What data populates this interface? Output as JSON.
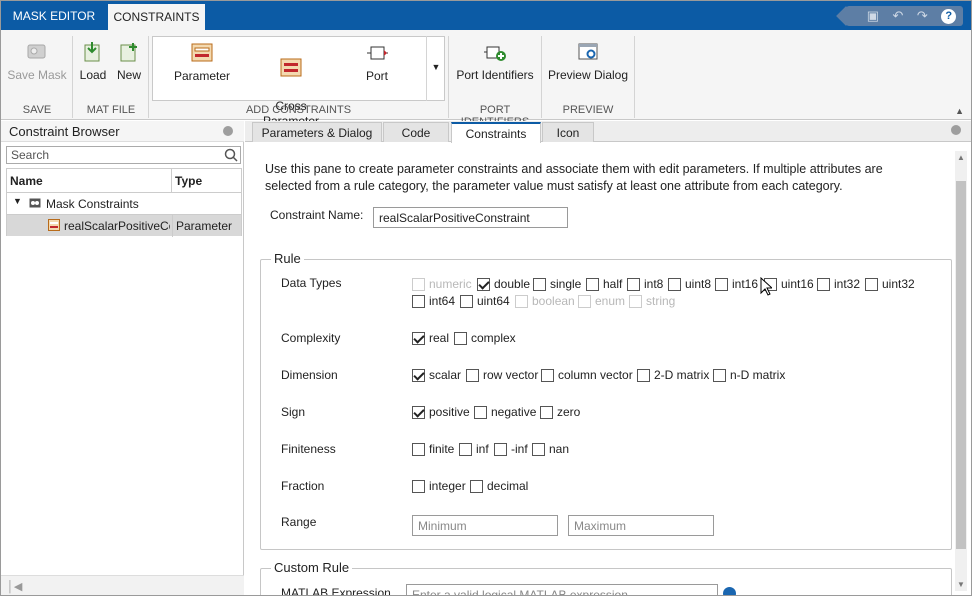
{
  "title_tabs": [
    {
      "label": "MASK EDITOR"
    },
    {
      "label": "CONSTRAINTS"
    }
  ],
  "quick_access": {
    "save_icon": "save-icon",
    "undo_icon": "undo-icon",
    "redo_icon": "redo-icon",
    "help_label": "?"
  },
  "ribbon": {
    "save_mask": "Save Mask",
    "load": "Load",
    "new": "New",
    "parameter": "Parameter",
    "cross_parameter": "Cross\nParameter",
    "port": "Port",
    "port_identifiers": "Port Identifiers",
    "preview_dialog": "Preview Dialog",
    "groups": {
      "save": "SAVE",
      "mat_file": "MAT FILE",
      "add_constraints": "ADD CONSTRAINTS",
      "port_identifiers": "PORT IDENTIFIERS",
      "preview": "PREVIEW"
    }
  },
  "browser": {
    "title": "Constraint Browser",
    "search_placeholder": "Search",
    "columns": [
      "Name",
      "Type"
    ],
    "root": "Mask Constraints",
    "rows": [
      {
        "name": "realScalarPositiveCo",
        "type": "Parameter"
      }
    ]
  },
  "main_tabs": [
    "Parameters & Dialog",
    "Code",
    "Constraints",
    "Icon"
  ],
  "description": "Use this pane to create parameter constraints and associate them with edit parameters. If multiple attributes are selected from a rule category, the parameter value must satisfy at least one attribute from each category.",
  "constraint_name_label": "Constraint Name:",
  "constraint_name_value": "realScalarPositiveConstraint",
  "rule": {
    "legend": "Rule",
    "data_types_label": "Data Types",
    "data_types": [
      {
        "label": "numeric",
        "checked": false,
        "disabled": true
      },
      {
        "label": "double",
        "checked": true,
        "disabled": false
      },
      {
        "label": "single",
        "checked": false,
        "disabled": false
      },
      {
        "label": "half",
        "checked": false,
        "disabled": false
      },
      {
        "label": "int8",
        "checked": false,
        "disabled": false
      },
      {
        "label": "uint8",
        "checked": false,
        "disabled": false
      },
      {
        "label": "int16",
        "checked": false,
        "disabled": false
      },
      {
        "label": "uint16",
        "checked": false,
        "disabled": false
      },
      {
        "label": "int32",
        "checked": false,
        "disabled": false
      },
      {
        "label": "uint32",
        "checked": false,
        "disabled": false
      },
      {
        "label": "int64",
        "checked": false,
        "disabled": false
      },
      {
        "label": "uint64",
        "checked": false,
        "disabled": false
      },
      {
        "label": "boolean",
        "checked": false,
        "disabled": true
      },
      {
        "label": "enum",
        "checked": false,
        "disabled": true
      },
      {
        "label": "string",
        "checked": false,
        "disabled": true
      }
    ],
    "complexity_label": "Complexity",
    "complexity": [
      {
        "label": "real",
        "checked": true
      },
      {
        "label": "complex",
        "checked": false
      }
    ],
    "dimension_label": "Dimension",
    "dimension": [
      {
        "label": "scalar",
        "checked": true
      },
      {
        "label": "row vector",
        "checked": false
      },
      {
        "label": "column vector",
        "checked": false
      },
      {
        "label": "2-D matrix",
        "checked": false
      },
      {
        "label": "n-D matrix",
        "checked": false
      }
    ],
    "sign_label": "Sign",
    "sign": [
      {
        "label": "positive",
        "checked": true
      },
      {
        "label": "negative",
        "checked": false
      },
      {
        "label": "zero",
        "checked": false
      }
    ],
    "finiteness_label": "Finiteness",
    "finiteness": [
      {
        "label": "finite",
        "checked": false
      },
      {
        "label": "inf",
        "checked": false
      },
      {
        "label": "-inf",
        "checked": false
      },
      {
        "label": "nan",
        "checked": false
      }
    ],
    "fraction_label": "Fraction",
    "fraction": [
      {
        "label": "integer",
        "checked": false
      },
      {
        "label": "decimal",
        "checked": false
      }
    ],
    "range_label": "Range",
    "range_min_placeholder": "Minimum",
    "range_max_placeholder": "Maximum"
  },
  "custom_rule": {
    "legend": "Custom Rule",
    "matlab_label": "MATLAB Expression",
    "matlab_placeholder": "Enter a valid logical MATLAB expression"
  }
}
